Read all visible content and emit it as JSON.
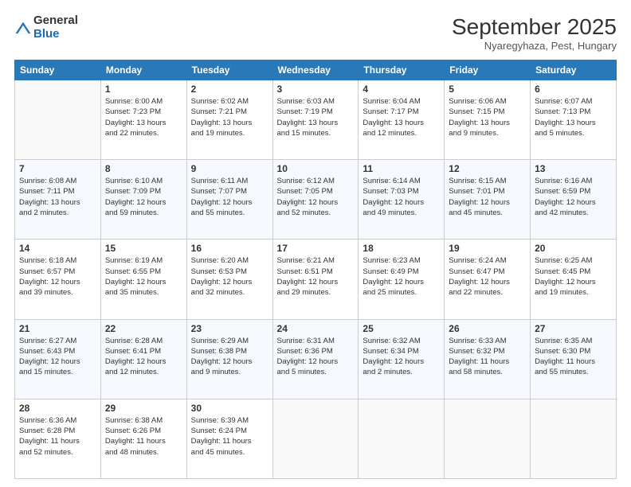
{
  "logo": {
    "general": "General",
    "blue": "Blue"
  },
  "title": {
    "month_year": "September 2025",
    "location": "Nyaregyhaza, Pest, Hungary"
  },
  "header_days": [
    "Sunday",
    "Monday",
    "Tuesday",
    "Wednesday",
    "Thursday",
    "Friday",
    "Saturday"
  ],
  "weeks": [
    [
      {
        "day": "",
        "info": ""
      },
      {
        "day": "1",
        "info": "Sunrise: 6:00 AM\nSunset: 7:23 PM\nDaylight: 13 hours\nand 22 minutes."
      },
      {
        "day": "2",
        "info": "Sunrise: 6:02 AM\nSunset: 7:21 PM\nDaylight: 13 hours\nand 19 minutes."
      },
      {
        "day": "3",
        "info": "Sunrise: 6:03 AM\nSunset: 7:19 PM\nDaylight: 13 hours\nand 15 minutes."
      },
      {
        "day": "4",
        "info": "Sunrise: 6:04 AM\nSunset: 7:17 PM\nDaylight: 13 hours\nand 12 minutes."
      },
      {
        "day": "5",
        "info": "Sunrise: 6:06 AM\nSunset: 7:15 PM\nDaylight: 13 hours\nand 9 minutes."
      },
      {
        "day": "6",
        "info": "Sunrise: 6:07 AM\nSunset: 7:13 PM\nDaylight: 13 hours\nand 5 minutes."
      }
    ],
    [
      {
        "day": "7",
        "info": "Sunrise: 6:08 AM\nSunset: 7:11 PM\nDaylight: 13 hours\nand 2 minutes."
      },
      {
        "day": "8",
        "info": "Sunrise: 6:10 AM\nSunset: 7:09 PM\nDaylight: 12 hours\nand 59 minutes."
      },
      {
        "day": "9",
        "info": "Sunrise: 6:11 AM\nSunset: 7:07 PM\nDaylight: 12 hours\nand 55 minutes."
      },
      {
        "day": "10",
        "info": "Sunrise: 6:12 AM\nSunset: 7:05 PM\nDaylight: 12 hours\nand 52 minutes."
      },
      {
        "day": "11",
        "info": "Sunrise: 6:14 AM\nSunset: 7:03 PM\nDaylight: 12 hours\nand 49 minutes."
      },
      {
        "day": "12",
        "info": "Sunrise: 6:15 AM\nSunset: 7:01 PM\nDaylight: 12 hours\nand 45 minutes."
      },
      {
        "day": "13",
        "info": "Sunrise: 6:16 AM\nSunset: 6:59 PM\nDaylight: 12 hours\nand 42 minutes."
      }
    ],
    [
      {
        "day": "14",
        "info": "Sunrise: 6:18 AM\nSunset: 6:57 PM\nDaylight: 12 hours\nand 39 minutes."
      },
      {
        "day": "15",
        "info": "Sunrise: 6:19 AM\nSunset: 6:55 PM\nDaylight: 12 hours\nand 35 minutes."
      },
      {
        "day": "16",
        "info": "Sunrise: 6:20 AM\nSunset: 6:53 PM\nDaylight: 12 hours\nand 32 minutes."
      },
      {
        "day": "17",
        "info": "Sunrise: 6:21 AM\nSunset: 6:51 PM\nDaylight: 12 hours\nand 29 minutes."
      },
      {
        "day": "18",
        "info": "Sunrise: 6:23 AM\nSunset: 6:49 PM\nDaylight: 12 hours\nand 25 minutes."
      },
      {
        "day": "19",
        "info": "Sunrise: 6:24 AM\nSunset: 6:47 PM\nDaylight: 12 hours\nand 22 minutes."
      },
      {
        "day": "20",
        "info": "Sunrise: 6:25 AM\nSunset: 6:45 PM\nDaylight: 12 hours\nand 19 minutes."
      }
    ],
    [
      {
        "day": "21",
        "info": "Sunrise: 6:27 AM\nSunset: 6:43 PM\nDaylight: 12 hours\nand 15 minutes."
      },
      {
        "day": "22",
        "info": "Sunrise: 6:28 AM\nSunset: 6:41 PM\nDaylight: 12 hours\nand 12 minutes."
      },
      {
        "day": "23",
        "info": "Sunrise: 6:29 AM\nSunset: 6:38 PM\nDaylight: 12 hours\nand 9 minutes."
      },
      {
        "day": "24",
        "info": "Sunrise: 6:31 AM\nSunset: 6:36 PM\nDaylight: 12 hours\nand 5 minutes."
      },
      {
        "day": "25",
        "info": "Sunrise: 6:32 AM\nSunset: 6:34 PM\nDaylight: 12 hours\nand 2 minutes."
      },
      {
        "day": "26",
        "info": "Sunrise: 6:33 AM\nSunset: 6:32 PM\nDaylight: 11 hours\nand 58 minutes."
      },
      {
        "day": "27",
        "info": "Sunrise: 6:35 AM\nSunset: 6:30 PM\nDaylight: 11 hours\nand 55 minutes."
      }
    ],
    [
      {
        "day": "28",
        "info": "Sunrise: 6:36 AM\nSunset: 6:28 PM\nDaylight: 11 hours\nand 52 minutes."
      },
      {
        "day": "29",
        "info": "Sunrise: 6:38 AM\nSunset: 6:26 PM\nDaylight: 11 hours\nand 48 minutes."
      },
      {
        "day": "30",
        "info": "Sunrise: 6:39 AM\nSunset: 6:24 PM\nDaylight: 11 hours\nand 45 minutes."
      },
      {
        "day": "",
        "info": ""
      },
      {
        "day": "",
        "info": ""
      },
      {
        "day": "",
        "info": ""
      },
      {
        "day": "",
        "info": ""
      }
    ]
  ]
}
